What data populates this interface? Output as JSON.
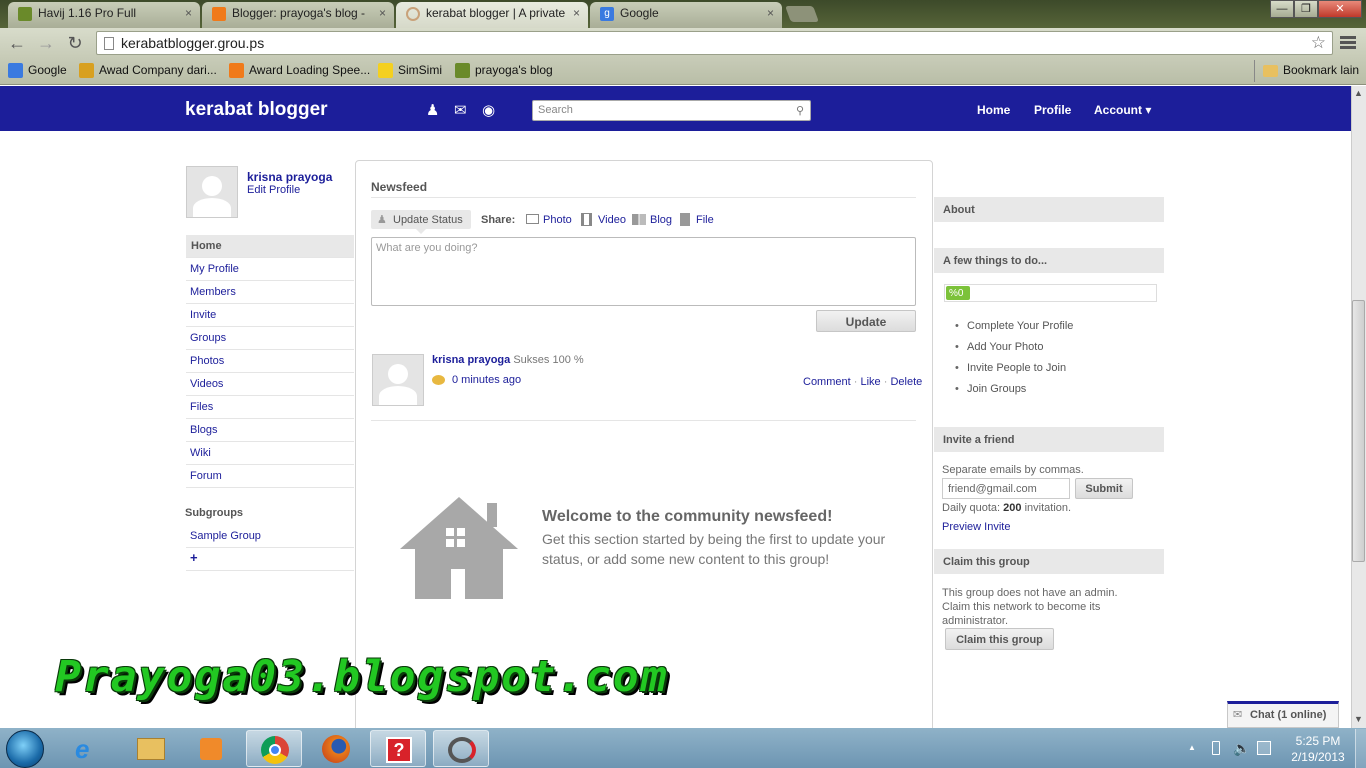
{
  "browser": {
    "tabs": [
      {
        "label": "Havij 1.16 Pro Full",
        "color": "#6a8a2a"
      },
      {
        "label": "Blogger: prayoga's blog -",
        "color": "#f07a1a"
      },
      {
        "label": "kerabat blogger | A private",
        "color": "#c9a27a"
      },
      {
        "label": "Google",
        "color": "#3a7ae0"
      }
    ],
    "tab_close": "×",
    "window_controls": {
      "minimize": "—",
      "restore": "❐",
      "close": "✕"
    },
    "address": "kerabatblogger.grou.ps",
    "bookmarks": [
      {
        "label": "Google",
        "color": "#3a7ae0"
      },
      {
        "label": "Awad Company dari...",
        "color": "#d8a020"
      },
      {
        "label": "Award Loading Spee...",
        "color": "#f07a1a"
      },
      {
        "label": "SimSimi",
        "color": "#f4d020"
      },
      {
        "label": "prayoga's blog",
        "color": "#6a8a2a"
      }
    ],
    "other_bookmarks": "Bookmark lain"
  },
  "site": {
    "brand": "kerabat blogger",
    "search_placeholder": "Search",
    "nav": {
      "home": "Home",
      "profile": "Profile",
      "account": "Account ▾"
    }
  },
  "left": {
    "user_name": "krisna prayoga",
    "edit_profile": "Edit Profile",
    "menu": [
      "Home",
      "My Profile",
      "Members",
      "Invite",
      "Groups",
      "Photos",
      "Videos",
      "Files",
      "Blogs",
      "Wiki",
      "Forum"
    ],
    "subgroups_title": "Subgroups",
    "subgroups": [
      "Sample Group"
    ],
    "add": "+"
  },
  "feed": {
    "title": "Newsfeed",
    "update_status": "Update Status",
    "share_label": "Share:",
    "share": [
      "Photo",
      "Video",
      "Blog",
      "File"
    ],
    "textarea_placeholder": "What are you doing?",
    "update_button": "Update",
    "post": {
      "author": "krisna prayoga",
      "text": "Sukses 100 %",
      "time": "0 minutes ago",
      "actions": [
        "Comment",
        "Like",
        "Delete"
      ],
      "separator": "·"
    },
    "welcome_title": "Welcome to the community newsfeed!",
    "welcome_text": "Get this section started by being the first to update your status, or add some new content to this group!"
  },
  "right": {
    "about": "About",
    "todo_title": "A few things to do...",
    "progress_label": "%0",
    "progress": 0.05,
    "todo": [
      "Complete Your Profile",
      "Add Your Photo",
      "Invite People to Join",
      "Join Groups"
    ],
    "invite_title": "Invite a friend",
    "invite_hint": "Separate emails by commas.",
    "invite_value": "friend@gmail.com",
    "submit": "Submit",
    "quota_prefix": "Daily quota:",
    "quota_value": "200",
    "quota_suffix": "invitation.",
    "preview": "Preview Invite",
    "claim_title": "Claim this group",
    "claim_text": "This group does not have an admin. Claim this network to become its administrator.",
    "claim_button": "Claim this group"
  },
  "chat": "Chat (1 online)",
  "watermark": "Prayoga03.blogspot.com",
  "taskbar": {
    "time": "5:25 PM",
    "date": "2/19/2013"
  }
}
